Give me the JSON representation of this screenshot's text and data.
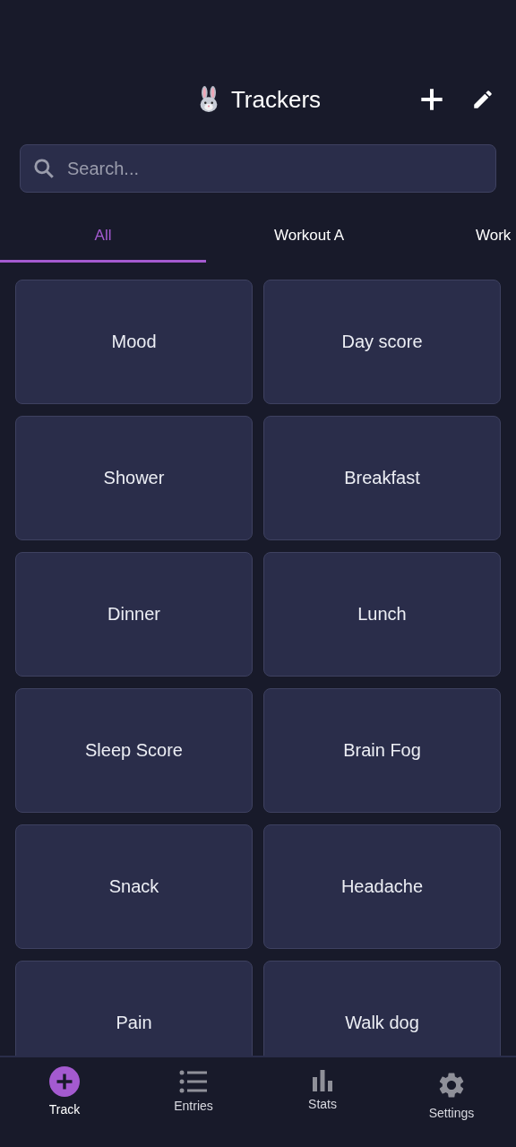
{
  "header": {
    "title": "Trackers"
  },
  "search": {
    "placeholder": "Search..."
  },
  "tabs": [
    {
      "label": "All",
      "selected": true
    },
    {
      "label": "Workout A",
      "selected": false
    },
    {
      "label": "Work",
      "selected": false
    }
  ],
  "trackers": [
    "Mood",
    "Day score",
    "Shower",
    "Breakfast",
    "Dinner",
    "Lunch",
    "Sleep Score",
    "Brain Fog",
    "Snack",
    "Headache",
    "Pain",
    "Walk dog"
  ],
  "nav": [
    {
      "label": "Track",
      "kind": "track",
      "selected": true
    },
    {
      "label": "Entries",
      "kind": "entries",
      "selected": false
    },
    {
      "label": "Stats",
      "kind": "stats",
      "selected": false
    },
    {
      "label": "Settings",
      "kind": "settings",
      "selected": false
    }
  ]
}
